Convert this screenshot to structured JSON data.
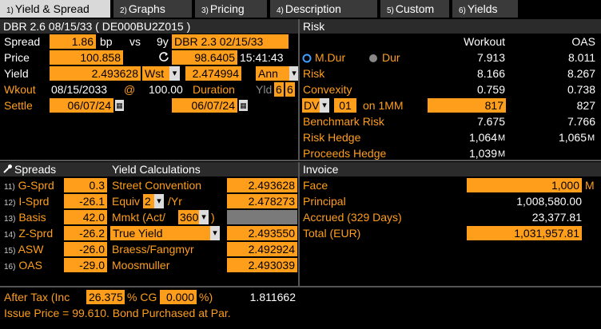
{
  "tabs": [
    {
      "num": "1)",
      "label": "Yield & Spread"
    },
    {
      "num": "2)",
      "label": "Graphs"
    },
    {
      "num": "3)",
      "label": "Pricing"
    },
    {
      "num": "4)",
      "label": "Description"
    },
    {
      "num": "5)",
      "label": "Custom"
    },
    {
      "num": "6)",
      "label": "Yields"
    }
  ],
  "security": {
    "title": "DBR 2.6 08/15/33 ( DE000BU2Z015 )"
  },
  "top": {
    "spread_label": "Spread",
    "spread_value": "1.86",
    "spread_unit": "bp",
    "vs": "vs",
    "bench_term": "9y",
    "bench_value": "DBR 2.3 02/15/33",
    "price_label": "Price",
    "price_value": "100.858",
    "bench_price": "98.6405",
    "time": "15:41:43",
    "yield_label": "Yield",
    "yield_value": "2.493628",
    "yield_type": "Wst",
    "bench_yield": "2.474994",
    "compounding": "Ann",
    "wkout_label": "Wkout",
    "wkout_date": "08/15/2033",
    "at": "@",
    "wkout_price": "100.00",
    "duration_label": "Duration",
    "yld_label": "Yld",
    "yld_v1": "6",
    "yld_v2": "6",
    "settle_label": "Settle",
    "settle_date": "06/07/24",
    "settle_date2": "06/07/24"
  },
  "risk": {
    "header": "Risk",
    "col1": "Workout",
    "col2": "OAS",
    "mdur_label": "M.Dur",
    "dur_label": "Dur",
    "mdur_workout": "7.913",
    "mdur_oas": "8.011",
    "rows": [
      {
        "label": "Risk",
        "workout": "8.166",
        "oas": "8.267"
      },
      {
        "label": "Convexity",
        "workout": "0.759",
        "oas": "0.738"
      }
    ],
    "dv_label": "DV",
    "dv_field": "01",
    "dv_on": "on 1MM",
    "dv_workout": "817",
    "dv_oas": "827",
    "rows2": [
      {
        "label": "Benchmark Risk",
        "workout": "7.675",
        "oas": "7.766"
      },
      {
        "label": "Risk Hedge",
        "workout": "1,064",
        "wunit": "M",
        "oas": "1,065",
        "ounit": "M"
      },
      {
        "label": "Proceeds Hedge",
        "workout": "1,039",
        "wunit": "M",
        "oas": "",
        "ounit": ""
      }
    ]
  },
  "spreads": {
    "header": "Spreads",
    "items": [
      {
        "num": "11)",
        "label": "G-Sprd",
        "value": "0.3"
      },
      {
        "num": "12)",
        "label": "I-Sprd",
        "value": "-26.1"
      },
      {
        "num": "13)",
        "label": "Basis",
        "value": "42.0"
      },
      {
        "num": "14)",
        "label": "Z-Sprd",
        "value": "-26.2"
      },
      {
        "num": "15)",
        "label": "ASW",
        "value": "-26.0"
      },
      {
        "num": "16)",
        "label": "OAS",
        "value": "-29.0"
      }
    ]
  },
  "yieldcalc": {
    "header": "Yield Calculations",
    "street_label": "Street Convention",
    "street_value": "2.493628",
    "equiv_label": "Equiv",
    "equiv_n": "2",
    "equiv_suffix": "/Yr",
    "equiv_value": "2.478273",
    "mmkt_label": "Mmkt (Act/",
    "mmkt_n": "360",
    "mmkt_close": ")",
    "true_label": "True Yield",
    "true_value": "2.493550",
    "braess_label": "Braess/Fangmyr",
    "braess_value": "2.492924",
    "moos_label": "Moosmuller",
    "moos_value": "2.493039"
  },
  "invoice": {
    "header": "Invoice",
    "face_label": "Face",
    "face_value": "1,000",
    "face_unit": "M",
    "principal_label": "Principal",
    "principal_value": "1,008,580.00",
    "accrued_label": "Accrued (329 Days)",
    "accrued_value": "23,377.81",
    "total_label": "Total  (EUR)",
    "total_value": "1,031,957.81"
  },
  "footer": {
    "aftertax_label": "After Tax (Inc",
    "inc_value": "26.375",
    "cg_label": "% CG",
    "cg_value": "0.000",
    "pct": "%)",
    "aftertax_value": "1.811662",
    "issue_note": "Issue Price = 99.610. Bond Purchased at Par."
  },
  "colors": {
    "accent": "#ff9e1b",
    "header_bg": "#2b2b2b",
    "tab_active": "#d9d9d9"
  }
}
